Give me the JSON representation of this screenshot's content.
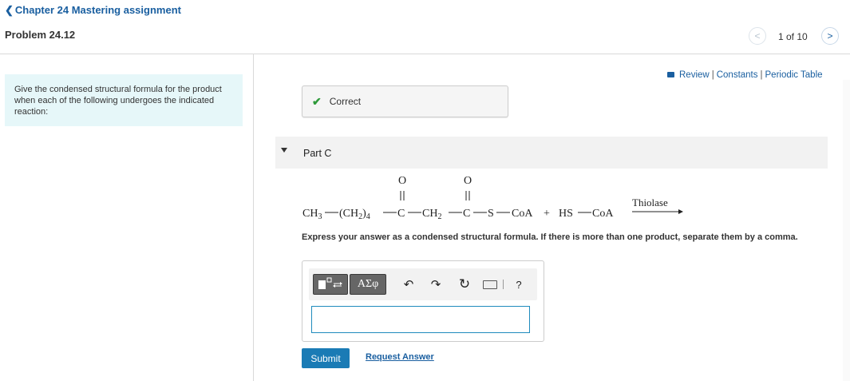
{
  "nav": {
    "back_label": "Chapter 24 Mastering assignment",
    "problem_title": "Problem 24.12",
    "pager": {
      "current": 1,
      "total": 10,
      "text": "1 of 10"
    }
  },
  "intro": {
    "text": "Give the condensed structural formula for the product when each of the following undergoes the indicated reaction:"
  },
  "resources": {
    "review": "Review",
    "constants": "Constants",
    "periodic_table": "Periodic Table",
    "separator": "|"
  },
  "feedback": {
    "status": "Correct"
  },
  "part": {
    "label": "Part C"
  },
  "equation": {
    "o1": "O",
    "o2": "O",
    "ch3": "CH",
    "ch3_sub": "3",
    "ch2n": "(CH",
    "ch2n_sub": "2",
    "ch2n_close": ")",
    "ch2n_n": "4",
    "c1": "C",
    "ch2": "CH",
    "ch2_sub": "2",
    "c2": "C",
    "s": "S",
    "coa1": "CoA",
    "plus": "+",
    "hs": "HS",
    "coa2": "CoA",
    "enzyme": "Thiolase"
  },
  "instructions": "Express your answer as a condensed structural formula. If there is more than one product, separate them by a comma.",
  "toolbar": {
    "greek_label": "ΑΣφ",
    "help_label": "?"
  },
  "answer": {
    "value": "",
    "placeholder": ""
  },
  "actions": {
    "submit": "Submit",
    "request_answer": "Request Answer"
  },
  "colors": {
    "link": "#1a5fa0",
    "intro_bg": "#e6f7f9",
    "success": "#2e9a3a",
    "submit_bg": "#1a7bb5",
    "input_border": "#1f8bbd"
  }
}
